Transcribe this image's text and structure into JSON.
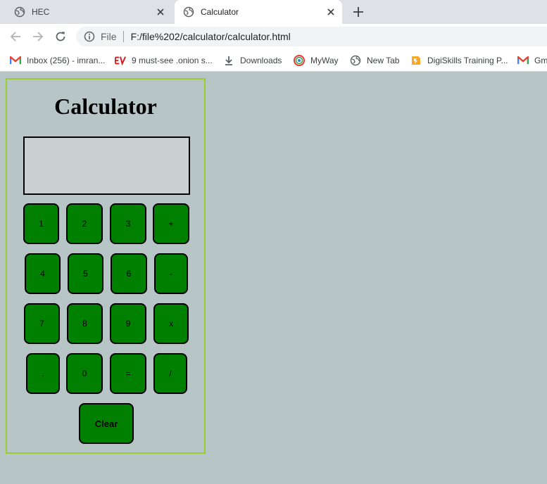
{
  "browser": {
    "tabs": [
      {
        "title": "HEC",
        "active": false,
        "favicon": "globe-icon"
      },
      {
        "title": "Calculator",
        "active": true,
        "favicon": "globe-icon"
      }
    ],
    "address": {
      "scheme_label": "File",
      "url": "F:/file%202/calculator/calculator.html"
    },
    "bookmarks": [
      {
        "label": "Inbox (256) - imran...",
        "icon": "gmail-icon"
      },
      {
        "label": "9 must-see .onion s...",
        "icon": "ev-icon"
      },
      {
        "label": "Downloads",
        "icon": "download-icon"
      },
      {
        "label": "MyWay",
        "icon": "myway-icon"
      },
      {
        "label": "New Tab",
        "icon": "globe-icon"
      },
      {
        "label": "DigiSkills Training P...",
        "icon": "digiskills-icon"
      },
      {
        "label": "Gm",
        "icon": "gmail-icon"
      }
    ]
  },
  "calculator": {
    "title": "Calculator",
    "display_value": "",
    "keys": [
      "1",
      "2",
      "3",
      "+",
      "4",
      "5",
      "6",
      "-",
      "7",
      "8",
      "9",
      "x",
      ".",
      "0",
      "=",
      "/"
    ],
    "clear_label": "Clear"
  },
  "colors": {
    "page_background": "#b7c5c6",
    "key_fill": "#008000",
    "panel_border": "#9acd32",
    "display_fill": "#c8d0d2"
  }
}
